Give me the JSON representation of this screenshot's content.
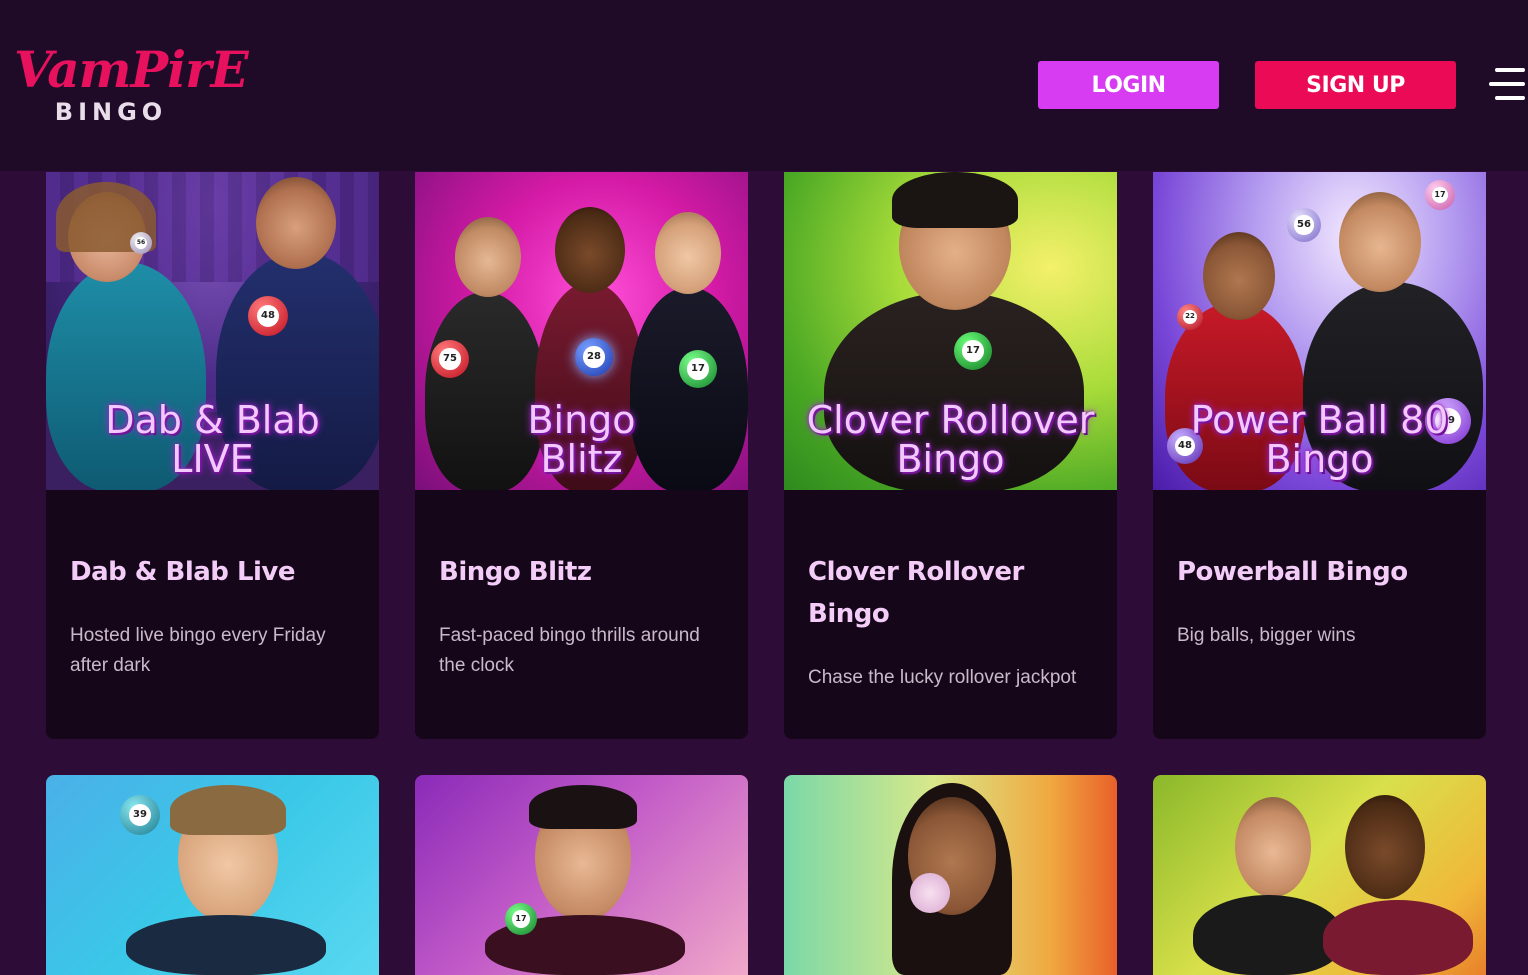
{
  "header": {
    "logo_top": "VamPirE",
    "logo_bottom": "BINGO",
    "login_label": "LOGIN",
    "signup_label": "SIGN UP"
  },
  "colors": {
    "background": "#2d0c37",
    "header_bg": "#1f0a28",
    "card_bg": "#15061a",
    "login_button": "#d73bf2",
    "signup_button": "#ea0a55",
    "logo_red": "#e8115e",
    "title_pink": "#f3cdf7"
  },
  "games": [
    {
      "thumb_title_line1": "Dab & Blab",
      "thumb_title_line2": "LIVE",
      "title": "Dab & Blab Live",
      "description": "Hosted live bingo every Friday after dark",
      "ball_numbers": [
        "48",
        "56"
      ]
    },
    {
      "thumb_title_line1": "Bingo",
      "thumb_title_line2": "Blitz",
      "title": "Bingo Blitz",
      "description": "Fast-paced bingo thrills around the clock",
      "ball_numbers": [
        "75",
        "28",
        "17"
      ]
    },
    {
      "thumb_title_line1": "Clover Rollover",
      "thumb_title_line2": "Bingo",
      "title": "Clover Rollover Bingo",
      "description": "Chase the lucky rollover jackpot",
      "ball_numbers": [
        "17"
      ]
    },
    {
      "thumb_title_line1": "Power Ball 80",
      "thumb_title_line2": "Bingo",
      "title": "Powerball Bingo",
      "description": "Big balls, bigger wins",
      "ball_numbers": [
        "56",
        "17",
        "22",
        "48",
        "39"
      ]
    }
  ],
  "row2_ball_numbers": [
    "39",
    "17"
  ]
}
